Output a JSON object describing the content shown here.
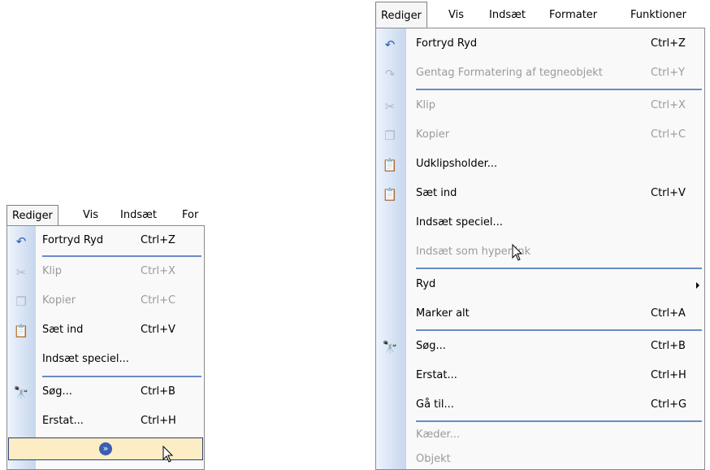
{
  "small_menu": {
    "menubar": [
      "Rediger",
      "Vis",
      "Indsæt",
      "For"
    ],
    "items": [
      {
        "icon": "undo-icon",
        "label": "Fortryd Ryd",
        "shortcut": "Ctrl+Z",
        "disabled": false
      },
      {
        "icon": "cut-icon",
        "label": "Klip",
        "shortcut": "Ctrl+X",
        "disabled": true
      },
      {
        "icon": "copy-icon",
        "label": "Kopier",
        "shortcut": "Ctrl+C",
        "disabled": true
      },
      {
        "icon": "paste-icon",
        "label": "Sæt ind",
        "shortcut": "Ctrl+V",
        "disabled": false
      },
      {
        "icon": "",
        "label": "Indsæt speciel...",
        "shortcut": "",
        "disabled": false
      },
      {
        "icon": "find-icon",
        "label": "Søg...",
        "shortcut": "Ctrl+B",
        "disabled": false
      },
      {
        "icon": "",
        "label": "Erstat...",
        "shortcut": "Ctrl+H",
        "disabled": false
      }
    ],
    "expand_icon": "chevron-double-down-icon"
  },
  "large_menu": {
    "menubar": [
      "Rediger",
      "Vis",
      "Indsæt",
      "Formater",
      "Funktioner"
    ],
    "items": [
      {
        "icon": "undo-icon",
        "label": "Fortryd Ryd",
        "shortcut": "Ctrl+Z",
        "disabled": false
      },
      {
        "icon": "redo-icon",
        "label": "Gentag Formatering af tegneobjekt",
        "shortcut": "Ctrl+Y",
        "disabled": true
      },
      {
        "icon": "cut-icon",
        "label": "Klip",
        "shortcut": "Ctrl+X",
        "disabled": true
      },
      {
        "icon": "copy-icon",
        "label": "Kopier",
        "shortcut": "Ctrl+C",
        "disabled": true
      },
      {
        "icon": "clipboard-icon",
        "label": "Udklipsholder...",
        "shortcut": "",
        "disabled": false
      },
      {
        "icon": "paste-icon",
        "label": "Sæt ind",
        "shortcut": "Ctrl+V",
        "disabled": false
      },
      {
        "icon": "",
        "label": "Indsæt speciel...",
        "shortcut": "",
        "disabled": false
      },
      {
        "icon": "",
        "label": "Indsæt som hyperlink",
        "shortcut": "",
        "disabled": true
      },
      {
        "icon": "",
        "label": "Ryd",
        "shortcut": "",
        "disabled": false,
        "submenu": true
      },
      {
        "icon": "",
        "label": "Marker alt",
        "shortcut": "Ctrl+A",
        "disabled": false
      },
      {
        "icon": "find-icon",
        "label": "Søg...",
        "shortcut": "Ctrl+B",
        "disabled": false
      },
      {
        "icon": "",
        "label": "Erstat...",
        "shortcut": "Ctrl+H",
        "disabled": false
      },
      {
        "icon": "",
        "label": "Gå til...",
        "shortcut": "Ctrl+G",
        "disabled": false
      },
      {
        "icon": "",
        "label": "Kæder...",
        "shortcut": "",
        "disabled": true
      },
      {
        "icon": "",
        "label": "Objekt",
        "shortcut": "",
        "disabled": true
      }
    ]
  },
  "colors": {
    "separator": "#6a8cc7",
    "expand_bg": "#fcedc4",
    "disabled_text": "#9a9a9a"
  }
}
